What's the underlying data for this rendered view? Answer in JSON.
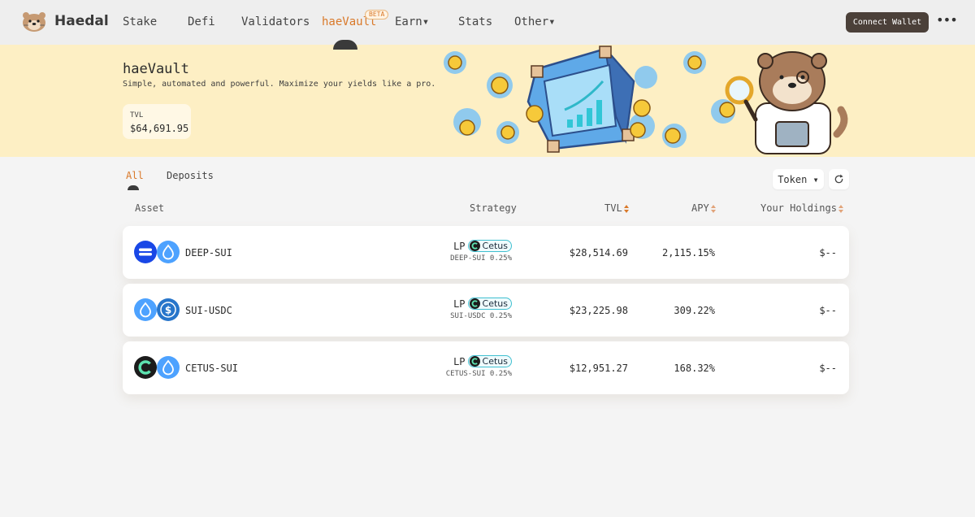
{
  "nav": {
    "brand": "Haedal",
    "items": [
      {
        "label": "Stake"
      },
      {
        "label": "Defi"
      },
      {
        "label": "Validators"
      },
      {
        "label": "haeVault"
      },
      {
        "label": "Earn▾"
      },
      {
        "label": "Stats"
      },
      {
        "label": "Other▾"
      }
    ],
    "active": "haeVault",
    "beta_badge": "BETA",
    "connect_wallet": "Connect Wallet",
    "more": "•••"
  },
  "hero": {
    "title": "haeVault",
    "subtitle": "Simple, automated and powerful. Maximize your yields like a pro.",
    "tvl_label": "TVL",
    "tvl_value": "$64,691.95"
  },
  "tabs": [
    {
      "label": "All"
    },
    {
      "label": "Deposits"
    }
  ],
  "active_tab": "All",
  "filter": {
    "token_label": "Token ▾"
  },
  "table": {
    "headers": {
      "asset": "Asset",
      "strategy": "Strategy",
      "tvl": "TVL",
      "apy": "APY",
      "holdings": "Your Holdings"
    },
    "rows": [
      {
        "asset": "DEEP-SUI",
        "strategy_type": "LP",
        "protocol": "Cetus",
        "pool": "DEEP-SUI 0.25%",
        "tvl": "$28,514.69",
        "apy": "2,115.15%",
        "holdings": "$--"
      },
      {
        "asset": "SUI-USDC",
        "strategy_type": "LP",
        "protocol": "Cetus",
        "pool": "SUI-USDC 0.25%",
        "tvl": "$23,225.98",
        "apy": "309.22%",
        "holdings": "$--"
      },
      {
        "asset": "CETUS-SUI",
        "strategy_type": "LP",
        "protocol": "Cetus",
        "pool": "CETUS-SUI 0.25%",
        "tvl": "$12,951.27",
        "apy": "168.32%",
        "holdings": "$--"
      }
    ]
  },
  "colors": {
    "accent": "#d9792a",
    "hero_bg": "#fdefc4",
    "connect_button": "#4b4039",
    "deep": "#1947e6",
    "sui": "#4da2ff",
    "usdc": "#2775ca",
    "cetus": "#1c1c1c"
  },
  "icons": {
    "logo": "otter-logo-icon",
    "refresh": "refresh-icon",
    "sort": "sort-arrows-icon",
    "deep": "deep-token-icon",
    "sui": "sui-token-icon",
    "usdc": "usdc-token-icon",
    "cetus": "cetus-token-icon"
  }
}
